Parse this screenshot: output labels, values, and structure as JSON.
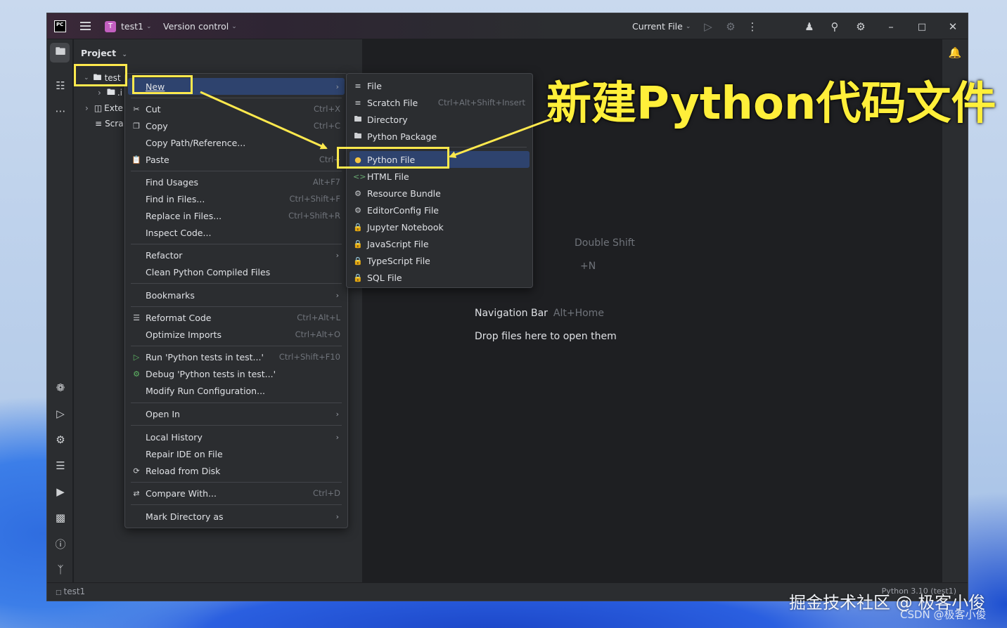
{
  "titlebar": {
    "logo": "PC",
    "project_badge": "T",
    "project_name": "test1",
    "vcs": "Version control",
    "run_config": "Current File",
    "icons": [
      "hamburger-icon",
      "run-icon",
      "debug-icon",
      "more-icon",
      "add-user-icon",
      "search-icon",
      "settings-icon",
      "minimize-icon",
      "maximize-icon",
      "close-icon"
    ]
  },
  "project_panel": {
    "title": "Project",
    "rows": [
      {
        "label": "test"
      },
      {
        "label": ".i"
      },
      {
        "label": "Exte"
      },
      {
        "label": "Scra"
      }
    ]
  },
  "context_menu": {
    "items": [
      {
        "label": "New",
        "shortcut": "",
        "submenu": true
      },
      {
        "label": "Cut",
        "shortcut": "Ctrl+X"
      },
      {
        "label": "Copy",
        "shortcut": "Ctrl+C"
      },
      {
        "label": "Copy Path/Reference...",
        "shortcut": ""
      },
      {
        "label": "Paste",
        "shortcut": "Ctrl+"
      },
      {
        "label": "Find Usages",
        "shortcut": "Alt+F7"
      },
      {
        "label": "Find in Files...",
        "shortcut": "Ctrl+Shift+F"
      },
      {
        "label": "Replace in Files...",
        "shortcut": "Ctrl+Shift+R"
      },
      {
        "label": "Inspect Code...",
        "shortcut": ""
      },
      {
        "label": "Refactor",
        "shortcut": "",
        "submenu": true
      },
      {
        "label": "Clean Python Compiled Files",
        "shortcut": ""
      },
      {
        "label": "Bookmarks",
        "shortcut": "",
        "submenu": true
      },
      {
        "label": "Reformat Code",
        "shortcut": "Ctrl+Alt+L"
      },
      {
        "label": "Optimize Imports",
        "shortcut": "Ctrl+Alt+O"
      },
      {
        "label": "Run 'Python tests in test...'",
        "shortcut": "Ctrl+Shift+F10"
      },
      {
        "label": "Debug 'Python tests in test...'",
        "shortcut": ""
      },
      {
        "label": "Modify Run Configuration...",
        "shortcut": ""
      },
      {
        "label": "Open In",
        "shortcut": "",
        "submenu": true
      },
      {
        "label": "Local History",
        "shortcut": "",
        "submenu": true
      },
      {
        "label": "Repair IDE on File",
        "shortcut": ""
      },
      {
        "label": "Reload from Disk",
        "shortcut": ""
      },
      {
        "label": "Compare With...",
        "shortcut": "Ctrl+D"
      },
      {
        "label": "Mark Directory as",
        "shortcut": "",
        "submenu": true
      }
    ]
  },
  "new_submenu": {
    "items": [
      {
        "label": "File",
        "shortcut": ""
      },
      {
        "label": "Scratch File",
        "shortcut": "Ctrl+Alt+Shift+Insert"
      },
      {
        "label": "Directory",
        "shortcut": ""
      },
      {
        "label": "Python Package",
        "shortcut": ""
      },
      {
        "label": "Python File",
        "shortcut": ""
      },
      {
        "label": "HTML File",
        "shortcut": ""
      },
      {
        "label": "Resource Bundle",
        "shortcut": ""
      },
      {
        "label": "EditorConfig File",
        "shortcut": ""
      },
      {
        "label": "Jupyter Notebook",
        "shortcut": ""
      },
      {
        "label": "JavaScript File",
        "shortcut": ""
      },
      {
        "label": "TypeScript File",
        "shortcut": ""
      },
      {
        "label": "SQL File",
        "shortcut": ""
      }
    ]
  },
  "editor_hints": {
    "search_everywhere_key": "Double Shift",
    "go_to_file_key": "+N",
    "nav_bar_label": "Navigation Bar",
    "nav_bar_key": "Alt+Home",
    "drop_files": "Drop files here to open them"
  },
  "statusbar": {
    "project": "test1",
    "interpreter": "Python 3.10 (test1)"
  },
  "annotation": {
    "title": "新建Python代码文件",
    "color": "#ffe94d"
  },
  "watermark": {
    "line1": "掘金技术社区 @ 极客小俊",
    "line2": "CSDN @极客小俊"
  },
  "colors": {
    "selection": "#2e436e",
    "panel_bg": "#2b2d30",
    "editor_bg": "#1e1f22",
    "accent_badge": "#c35fc0"
  }
}
